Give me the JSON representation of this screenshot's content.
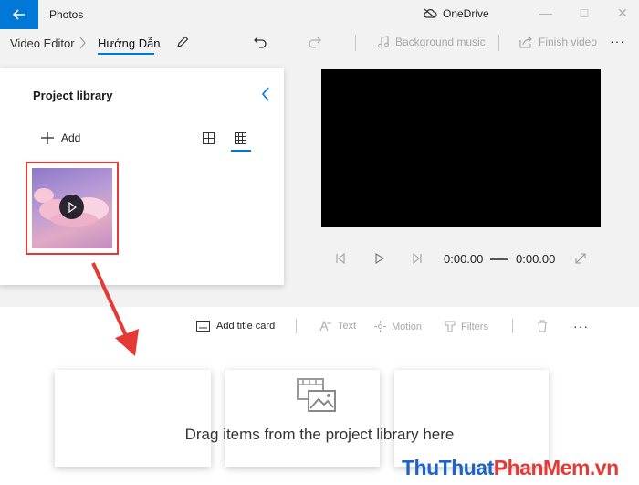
{
  "titlebar": {
    "app_title": "Photos",
    "onedrive_label": "OneDrive",
    "accent": "#0078d7"
  },
  "toolbar": {
    "breadcrumb_root": "Video Editor",
    "project_name": "Hướng Dẫn",
    "background_music": "Background music",
    "finish_video": "Finish video"
  },
  "library": {
    "title": "Project library",
    "add_label": "Add"
  },
  "player": {
    "current_time": "0:00.00",
    "total_time": "0:00.00"
  },
  "storyboard": {
    "add_title_card": "Add title card",
    "text": "Text",
    "motion": "Motion",
    "filters": "Filters",
    "drag_hint": "Drag items from the project library here"
  },
  "watermark": {
    "part1": "Thu",
    "part2": "Thuat",
    "part3": "PhanMem",
    "part4": ".vn"
  },
  "annotation_color": "#e53935"
}
